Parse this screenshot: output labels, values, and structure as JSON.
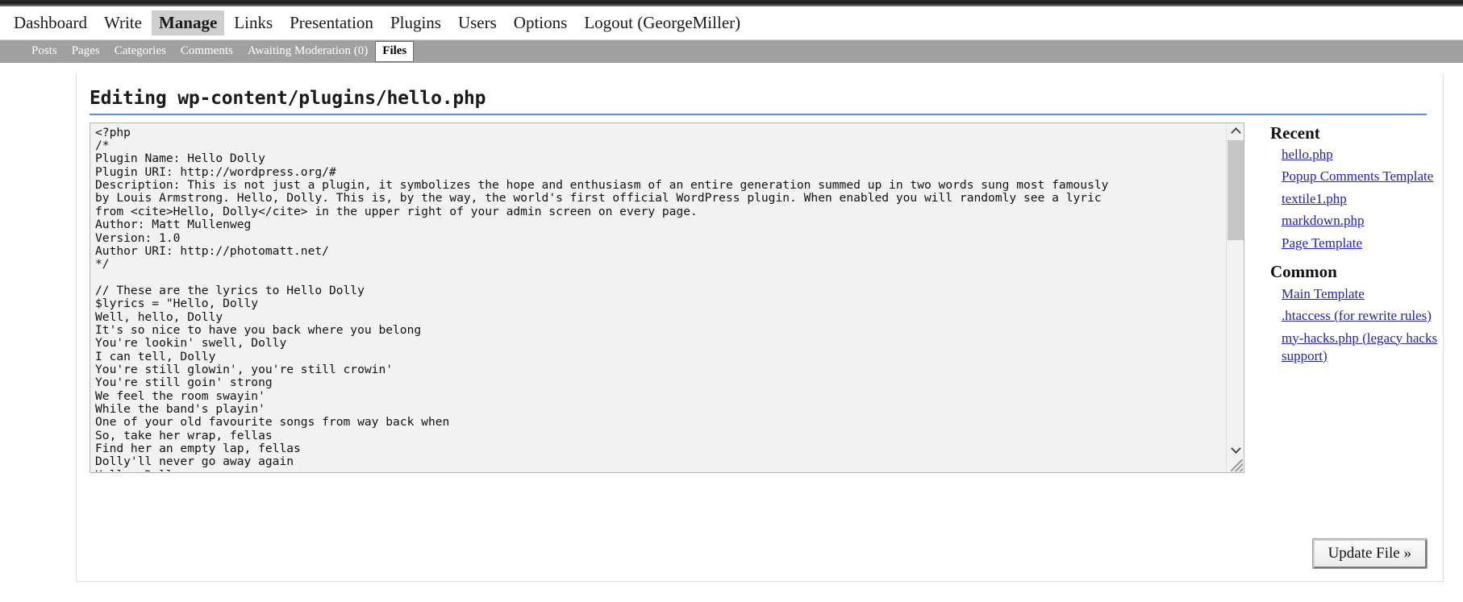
{
  "primary_nav": {
    "items": [
      {
        "label": "Dashboard",
        "current": false
      },
      {
        "label": "Write",
        "current": false
      },
      {
        "label": "Manage",
        "current": true
      },
      {
        "label": "Links",
        "current": false
      },
      {
        "label": "Presentation",
        "current": false
      },
      {
        "label": "Plugins",
        "current": false
      },
      {
        "label": "Users",
        "current": false
      },
      {
        "label": "Options",
        "current": false
      },
      {
        "label": "Logout (GeorgeMiller)",
        "current": false
      }
    ]
  },
  "secondary_nav": {
    "items": [
      {
        "label": "Posts",
        "current": false
      },
      {
        "label": "Pages",
        "current": false
      },
      {
        "label": "Categories",
        "current": false
      },
      {
        "label": "Comments",
        "current": false
      },
      {
        "label": "Awaiting Moderation (0)",
        "current": false
      },
      {
        "label": "Files",
        "current": true
      }
    ]
  },
  "editor": {
    "heading_prefix": "Editing ",
    "file_path": "wp-content/plugins/hello.php",
    "code": "<?php\n/*\nPlugin Name: Hello Dolly\nPlugin URI: http://wordpress.org/#\nDescription: This is not just a plugin, it symbolizes the hope and enthusiasm of an entire generation summed up in two words sung most famously\nby Louis Armstrong. Hello, Dolly. This is, by the way, the world's first official WordPress plugin. When enabled you will randomly see a lyric\nfrom <cite>Hello, Dolly</cite> in the upper right of your admin screen on every page.\nAuthor: Matt Mullenweg\nVersion: 1.0\nAuthor URI: http://photomatt.net/\n*/\n\n// These are the lyrics to Hello Dolly\n$lyrics = \"Hello, Dolly\nWell, hello, Dolly\nIt's so nice to have you back where you belong\nYou're lookin' swell, Dolly\nI can tell, Dolly\nYou're still glowin', you're still crowin'\nYou're still goin' strong\nWe feel the room swayin'\nWhile the band's playin'\nOne of your old favourite songs from way back when\nSo, take her wrap, fellas\nFind her an empty lap, fellas\nDolly'll never go away again\nHello, Dolly",
    "submit_label": "Update File »"
  },
  "sidebar": {
    "recent_heading": "Recent",
    "recent_items": [
      {
        "label": "hello.php"
      },
      {
        "label": "Popup Comments Template"
      },
      {
        "label": "textile1.php"
      },
      {
        "label": "markdown.php"
      },
      {
        "label": "Page Template"
      }
    ],
    "common_heading": "Common",
    "common_items": [
      {
        "label": "Main Template"
      },
      {
        "label": ".htaccess (for rewrite rules)"
      },
      {
        "label": "my-hacks.php (legacy hacks support)"
      }
    ]
  },
  "colors": {
    "accent_rule": "#5a90cd",
    "subnav_bg": "#a0a0a0",
    "current_tab_bg": "#cfcfcf",
    "link": "#2020c0"
  }
}
